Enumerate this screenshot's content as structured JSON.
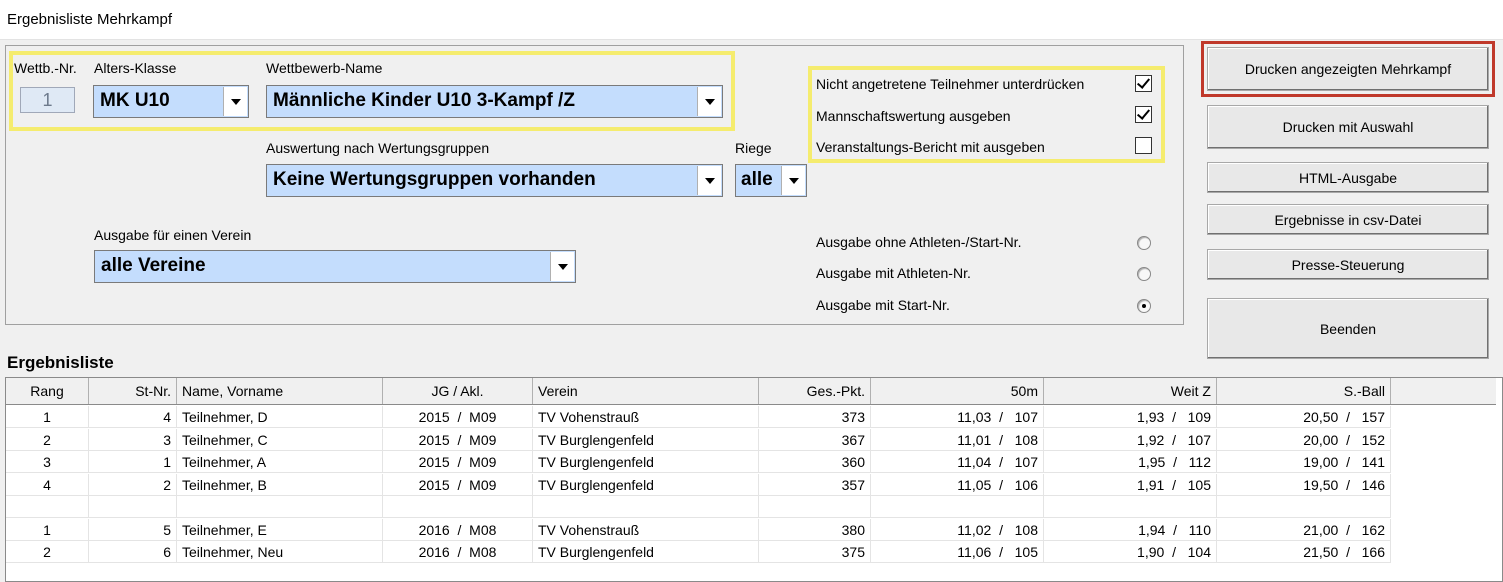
{
  "window": {
    "title": "Ergebnisliste Mehrkampf"
  },
  "filters": {
    "wettb_nr_label": "Wettb.-Nr.",
    "wettb_nr_value": "1",
    "alters_klasse_label": "Alters-Klasse",
    "alters_klasse_value": "MK U10",
    "wettbewerb_name_label": "Wettbewerb-Name",
    "wettbewerb_name_value": "Männliche Kinder U10  3-Kampf /Z",
    "wertungsgruppen_label": "Auswertung nach Wertungsgruppen",
    "wertungsgruppen_value": "Keine Wertungsgruppen vorhanden",
    "riege_label": "Riege",
    "riege_value": "alle",
    "verein_label": "Ausgabe für einen Verein",
    "verein_value": "alle Vereine"
  },
  "options": {
    "checkboxes": [
      {
        "label": "Nicht angetretene Teilnehmer unterdrücken",
        "checked": true
      },
      {
        "label": "Mannschaftswertung ausgeben",
        "checked": true
      },
      {
        "label": "Veranstaltungs-Bericht mit ausgeben",
        "checked": false
      }
    ],
    "radios": [
      {
        "label": "Ausgabe ohne Athleten-/Start-Nr.",
        "selected": false
      },
      {
        "label": "Ausgabe mit Athleten-Nr.",
        "selected": false
      },
      {
        "label": "Ausgabe mit Start-Nr.",
        "selected": true
      }
    ]
  },
  "buttons": {
    "print_displayed": "Drucken angezeigten Mehrkampf",
    "print_selection": "Drucken mit Auswahl",
    "html_output": "HTML-Ausgabe",
    "csv_output": "Ergebnisse in csv-Datei",
    "press_control": "Presse-Steuerung",
    "close": "Beenden"
  },
  "results": {
    "title": "Ergebnisliste",
    "columns": [
      "Rang",
      "St-Nr.",
      "Name, Vorname",
      "JG  /  Akl.",
      "Verein",
      "Ges.-Pkt.",
      "50m",
      "Weit Z",
      "S.-Ball"
    ],
    "rows": [
      [
        "1",
        "4",
        "Teilnehmer, D",
        "2015  /  M09",
        "TV Vohenstrauß",
        "373",
        "11,03  /   107",
        "1,93  /   109",
        "20,50  /   157"
      ],
      [
        "2",
        "3",
        "Teilnehmer, C",
        "2015  /  M09",
        "TV Burglengenfeld",
        "367",
        "11,01  /   108",
        "1,92  /   107",
        "20,00  /   152"
      ],
      [
        "3",
        "1",
        "Teilnehmer, A",
        "2015  /  M09",
        "TV Burglengenfeld",
        "360",
        "11,04  /   107",
        "1,95  /   112",
        "19,00  /   141"
      ],
      [
        "4",
        "2",
        "Teilnehmer, B",
        "2015  /  M09",
        "TV Burglengenfeld",
        "357",
        "11,05  /   106",
        "1,91  /   105",
        "19,50  /   146"
      ],
      [
        "",
        "",
        "",
        "",
        "",
        "",
        "",
        "",
        ""
      ],
      [
        "1",
        "5",
        "Teilnehmer, E",
        "2016  /  M08",
        "TV Vohenstrauß",
        "380",
        "11,02  /   108",
        "1,94  /   110",
        "21,00  /   162"
      ],
      [
        "2",
        "6",
        "Teilnehmer, Neu",
        "2016  /  M08",
        "TV Burglengenfeld",
        "375",
        "11,06  /   105",
        "1,90  /   104",
        "21,50  /   166"
      ]
    ]
  }
}
